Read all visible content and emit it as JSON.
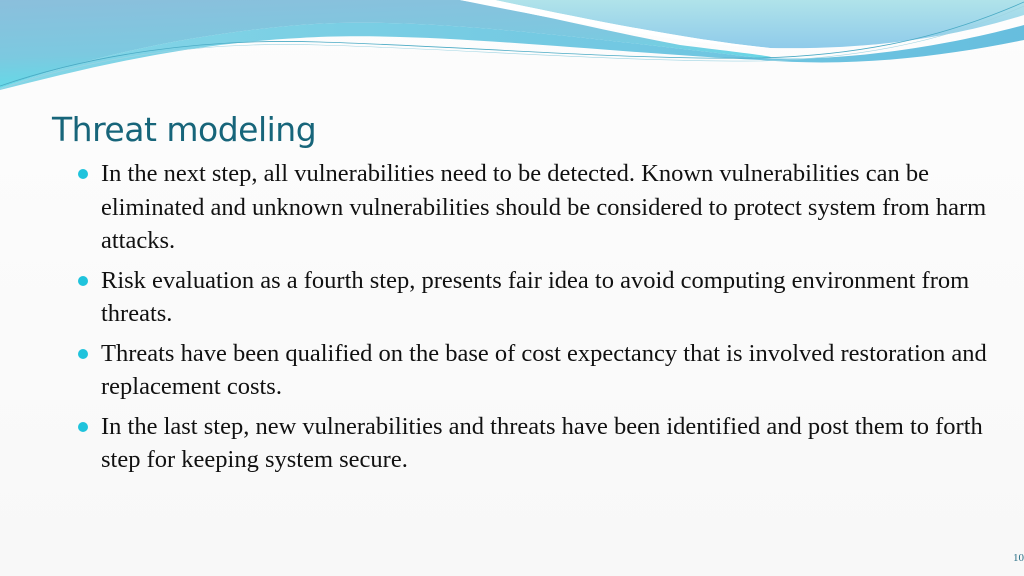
{
  "slide": {
    "title": "Threat modeling",
    "bullets": [
      {
        "icon": "bullet-dot",
        "text": "In the next step, all vulnerabilities need to be detected. Known vulnerabilities can be eliminated and unknown vulnerabilities should be considered to protect system from harm attacks."
      },
      {
        "icon": "bullet-dot",
        "text": "Risk evaluation as a fourth step, presents fair idea to avoid computing environment from threats."
      },
      {
        "icon": "bullet-dot",
        "text": "Threats have been qualified on the base of cost expectancy that is involved restoration and replacement costs."
      },
      {
        "icon": "bullet-dot",
        "text": "In the last step, new vulnerabilities and threats have been identified and post them to forth step for keeping system secure."
      }
    ],
    "page_number": "10"
  },
  "theme": {
    "title_color": "#17657a",
    "bullet_color": "#1fc3dc",
    "wave_colors": [
      "#86c0dc",
      "#6fd3e6",
      "#a9e1ea",
      "#4fb8dc"
    ]
  }
}
